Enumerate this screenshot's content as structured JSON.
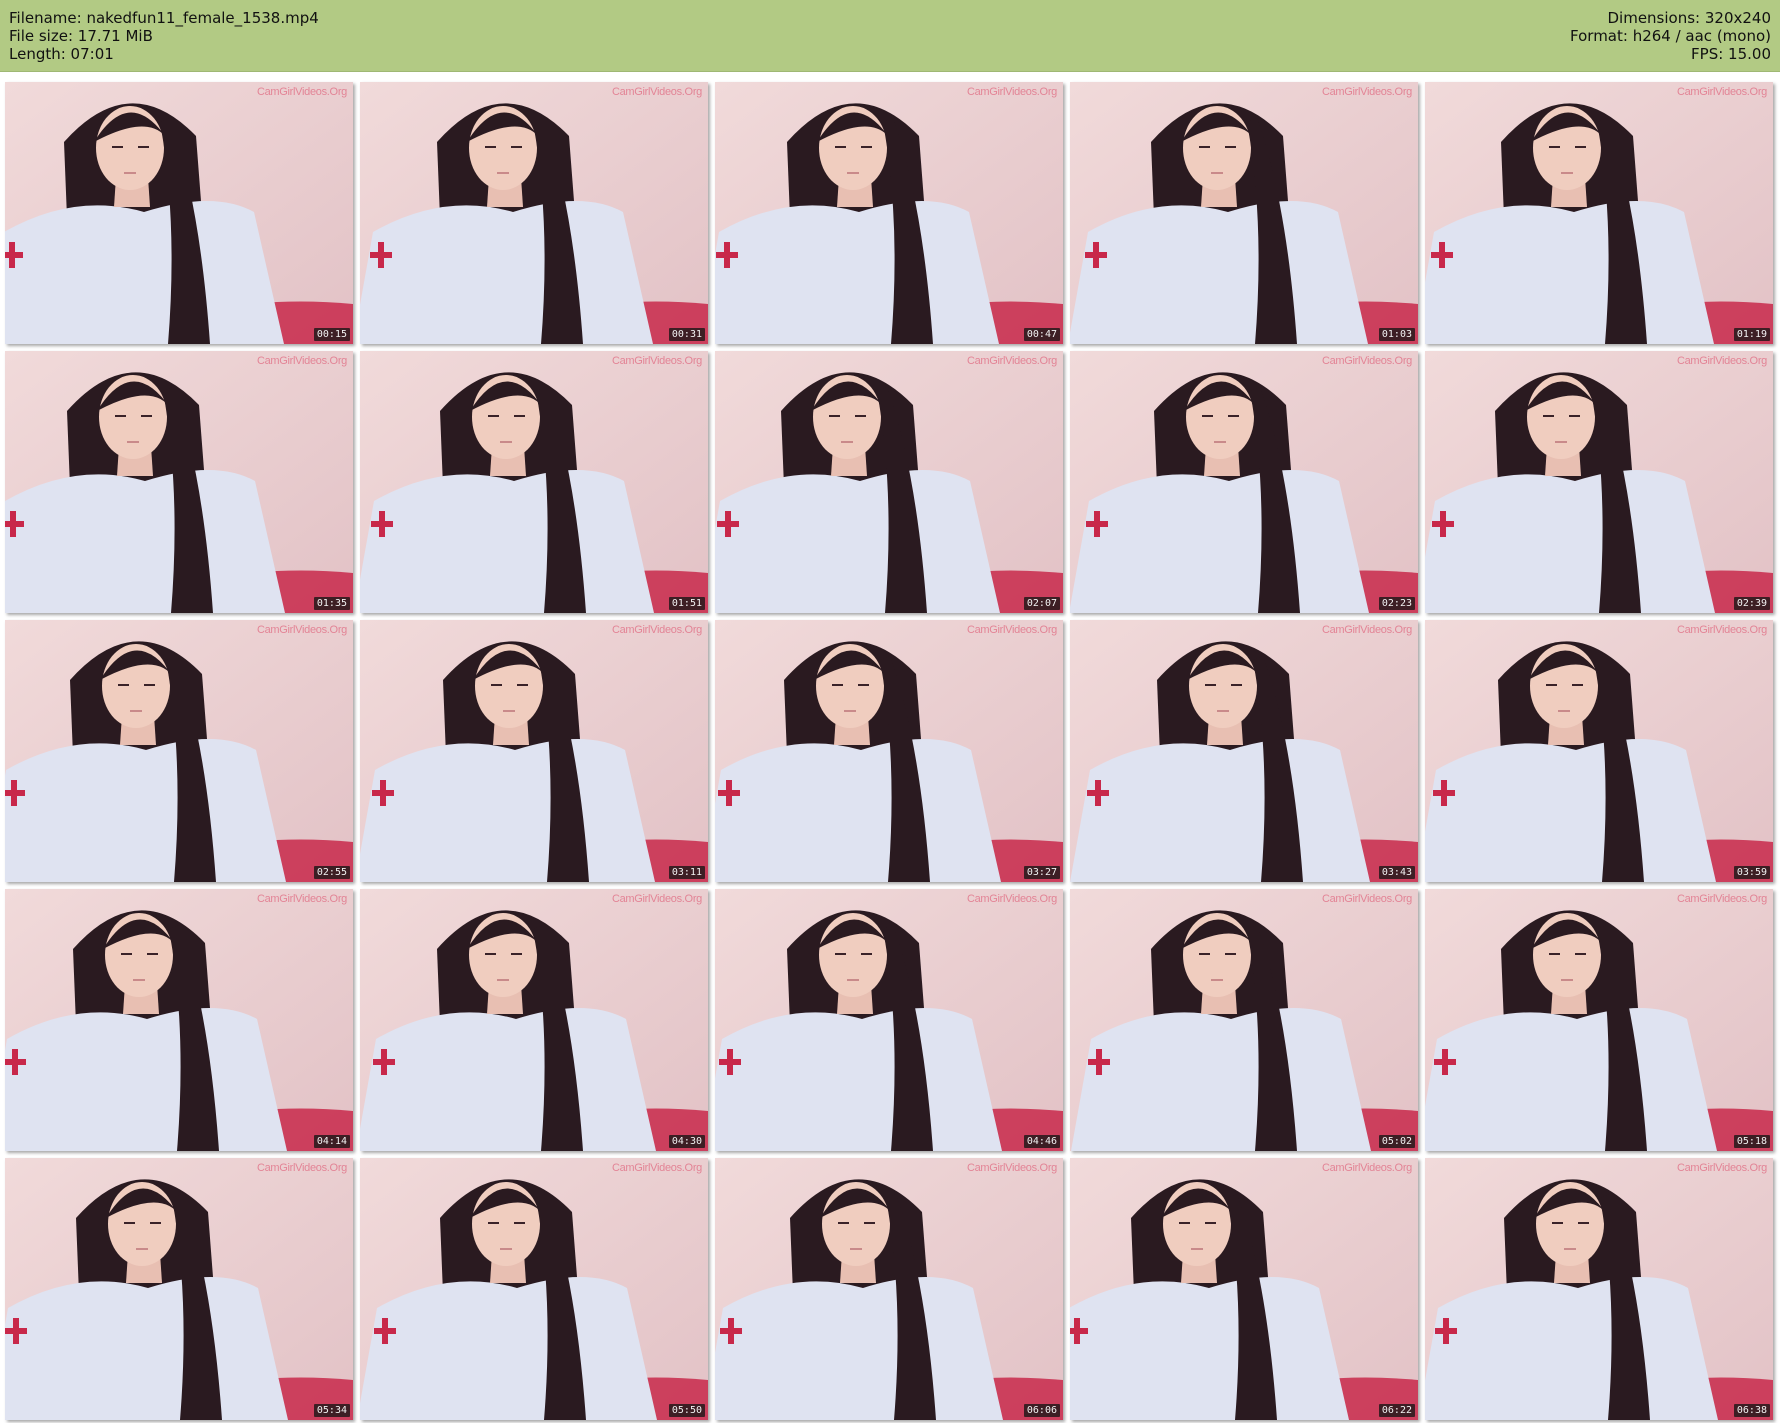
{
  "header": {
    "filename_label": "Filename: nakedfun11_female_1538.mp4",
    "filesize_label": "File size: 17.71 MiB",
    "length_label": "Length: 07:01",
    "dimensions_label": "Dimensions: 320x240",
    "format_label": "Format: h264 / aac (mono)",
    "fps_label": "FPS: 15.00"
  },
  "watermark": "CamGirlVideos.Org",
  "colors": {
    "header_bg": "#b2ca84",
    "background": "#ffffff",
    "wall": "#edd3d3",
    "shirt": "#dfe3f1",
    "hair": "#2a1a20",
    "accent_red": "#c8284a"
  },
  "thumbnails": [
    {
      "timestamp": "00:15"
    },
    {
      "timestamp": "00:31"
    },
    {
      "timestamp": "00:47"
    },
    {
      "timestamp": "01:03"
    },
    {
      "timestamp": "01:19"
    },
    {
      "timestamp": "01:35"
    },
    {
      "timestamp": "01:51"
    },
    {
      "timestamp": "02:07"
    },
    {
      "timestamp": "02:23"
    },
    {
      "timestamp": "02:39"
    },
    {
      "timestamp": "02:55"
    },
    {
      "timestamp": "03:11"
    },
    {
      "timestamp": "03:27"
    },
    {
      "timestamp": "03:43"
    },
    {
      "timestamp": "03:59"
    },
    {
      "timestamp": "04:14"
    },
    {
      "timestamp": "04:30"
    },
    {
      "timestamp": "04:46"
    },
    {
      "timestamp": "05:02"
    },
    {
      "timestamp": "05:18"
    },
    {
      "timestamp": "05:34"
    },
    {
      "timestamp": "05:50"
    },
    {
      "timestamp": "06:06"
    },
    {
      "timestamp": "06:22"
    },
    {
      "timestamp": "06:38"
    }
  ]
}
